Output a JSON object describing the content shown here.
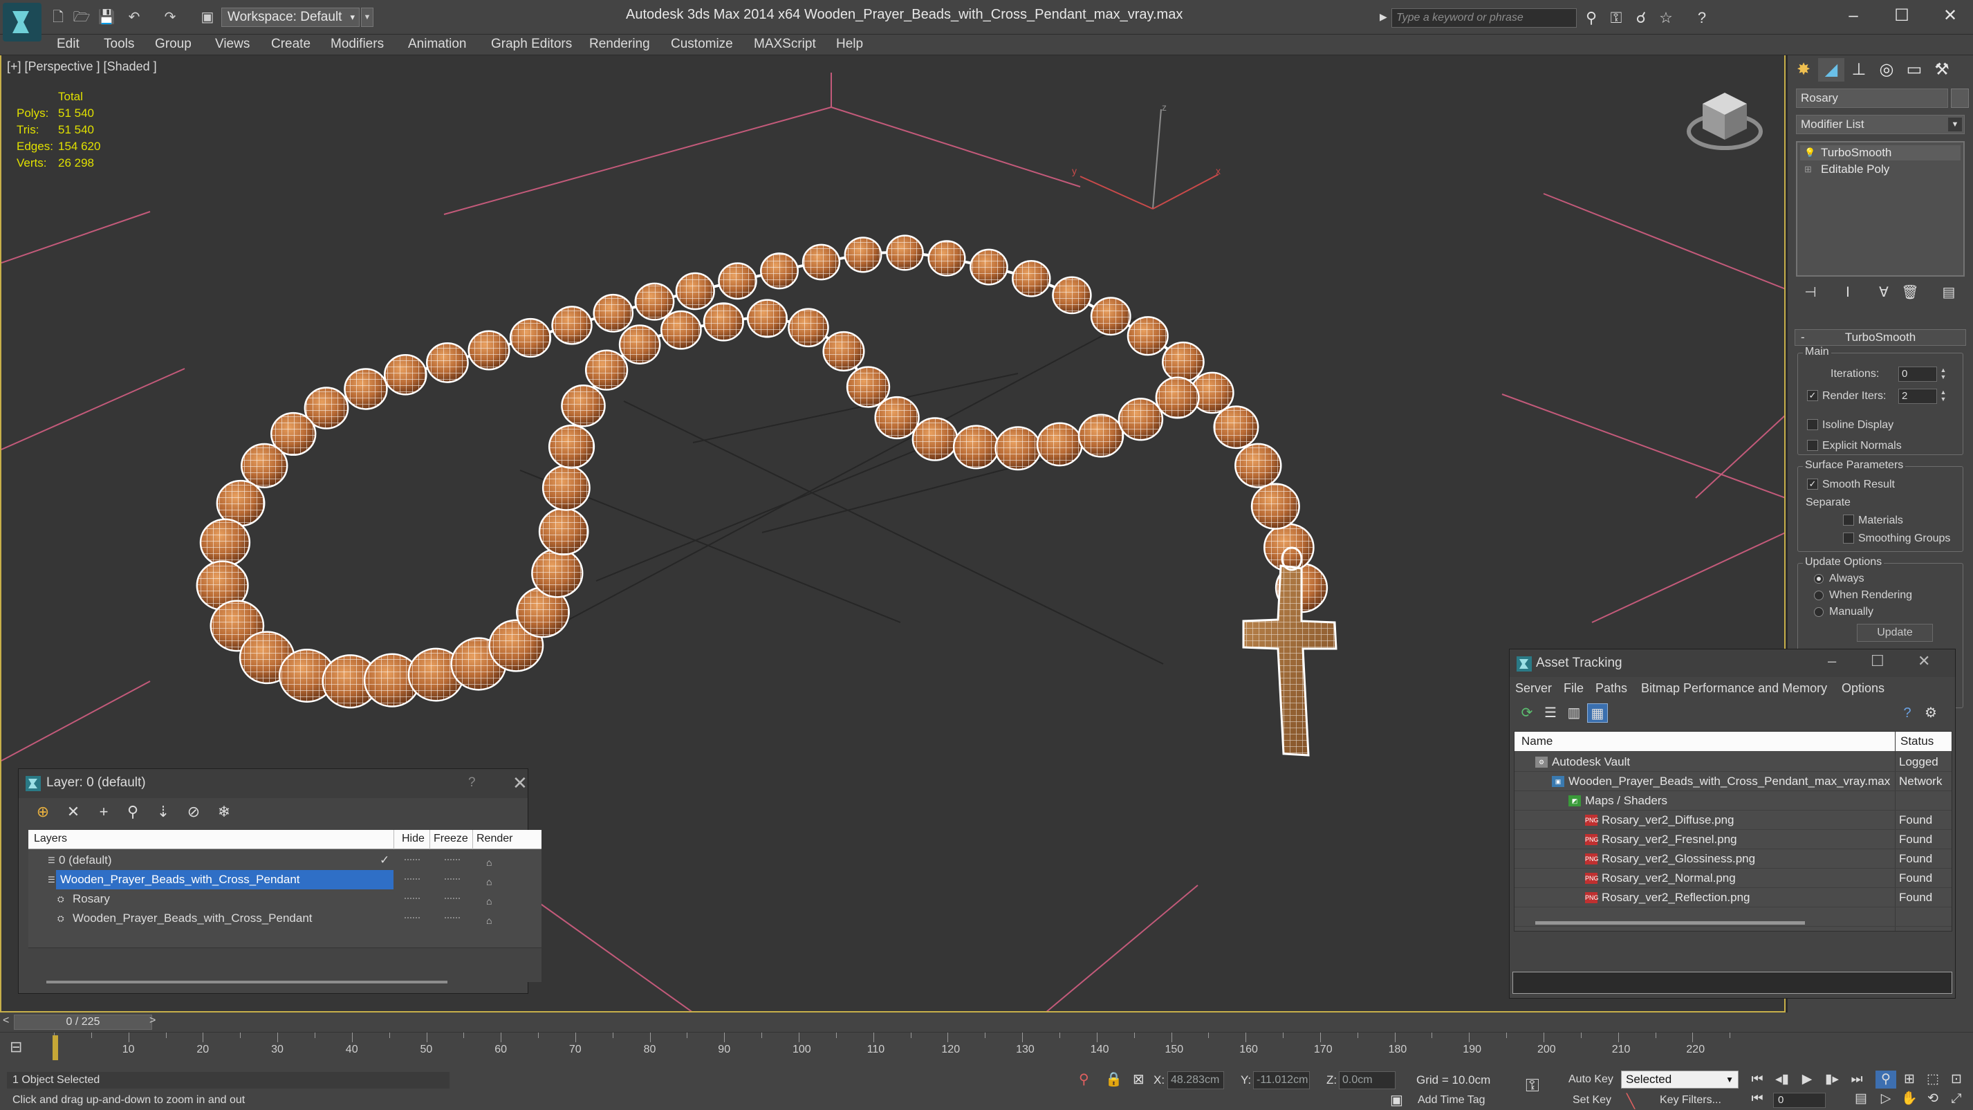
{
  "titlebar": {
    "workspace": "Workspace: Default",
    "app_title": "Autodesk 3ds Max  2014 x64",
    "file_title": "Wooden_Prayer_Beads_with_Cross_Pendant_max_vray.max",
    "search_placeholder": "Type a keyword or phrase",
    "minimize": "–",
    "maximize": "☐",
    "close": "✕"
  },
  "menubar": {
    "items": [
      "Edit",
      "Tools",
      "Group",
      "Views",
      "Create",
      "Modifiers",
      "Animation",
      "Graph Editors",
      "Rendering",
      "Customize",
      "MAXScript",
      "Help"
    ]
  },
  "viewport": {
    "label": "[+] [Perspective ] [Shaded ]",
    "stats": {
      "total_label": "Total",
      "rows": [
        {
          "k": "Polys:",
          "v": "51 540"
        },
        {
          "k": "Tris:",
          "v": "51 540"
        },
        {
          "k": "Edges:",
          "v": "154 620"
        },
        {
          "k": "Verts:",
          "v": "26 298"
        }
      ]
    },
    "axis_labels": {
      "y": "y",
      "x": "x",
      "z": "z"
    }
  },
  "command_panel": {
    "object_name": "Rosary",
    "modifier_list": "Modifier List",
    "stack": [
      "TurboSmooth",
      "Editable Poly"
    ],
    "rollout_title": "TurboSmooth",
    "main_group": "Main",
    "iterations_label": "Iterations:",
    "iterations_value": "0",
    "render_iters_label": "Render Iters:",
    "render_iters_value": "2",
    "isoline": "Isoline Display",
    "explicit_normals": "Explicit Normals",
    "surface_group": "Surface Parameters",
    "smooth_result": "Smooth Result",
    "separate": "Separate",
    "materials": "Materials",
    "smoothing_groups": "Smoothing Groups",
    "update_group": "Update Options",
    "always": "Always",
    "when_rendering": "When Rendering",
    "manually": "Manually",
    "update_btn": "Update"
  },
  "layer_window": {
    "title": "Layer: 0 (default)",
    "help": "?",
    "close": "✕",
    "headers": {
      "layers": "Layers",
      "hide": "Hide",
      "freeze": "Freeze",
      "render": "Render"
    },
    "rows": [
      {
        "name": "0 (default)",
        "indent": 0,
        "selected": false,
        "check": "✓"
      },
      {
        "name": "Wooden_Prayer_Beads_with_Cross_Pendant",
        "indent": 0,
        "selected": true,
        "check": ""
      },
      {
        "name": "Rosary",
        "indent": 1,
        "selected": false,
        "check": ""
      },
      {
        "name": "Wooden_Prayer_Beads_with_Cross_Pendant",
        "indent": 1,
        "selected": false,
        "check": ""
      }
    ]
  },
  "asset_window": {
    "title": "Asset Tracking",
    "menu": [
      "Server",
      "File",
      "Paths",
      "Bitmap Performance and Memory",
      "Options"
    ],
    "headers": {
      "name": "Name",
      "status": "Status"
    },
    "rows": [
      {
        "name": "Autodesk Vault",
        "status": "Logged",
        "indent": 0,
        "icon": "vault"
      },
      {
        "name": "Wooden_Prayer_Beads_with_Cross_Pendant_max_vray.max",
        "status": "Network",
        "indent": 1,
        "icon": "max"
      },
      {
        "name": "Maps / Shaders",
        "status": "",
        "indent": 2,
        "icon": "maps"
      },
      {
        "name": "Rosary_ver2_Diffuse.png",
        "status": "Found",
        "indent": 3,
        "icon": "png"
      },
      {
        "name": "Rosary_ver2_Fresnel.png",
        "status": "Found",
        "indent": 3,
        "icon": "png"
      },
      {
        "name": "Rosary_ver2_Glossiness.png",
        "status": "Found",
        "indent": 3,
        "icon": "png"
      },
      {
        "name": "Rosary_ver2_Normal.png",
        "status": "Found",
        "indent": 3,
        "icon": "png"
      },
      {
        "name": "Rosary_ver2_Reflection.png",
        "status": "Found",
        "indent": 3,
        "icon": "png"
      }
    ]
  },
  "timeline": {
    "slider": "0 / 225",
    "ticks": [
      0,
      10,
      20,
      30,
      40,
      50,
      60,
      70,
      80,
      90,
      100,
      110,
      120,
      130,
      140,
      150,
      160,
      170,
      180,
      190,
      200,
      210,
      220
    ]
  },
  "statusbar": {
    "selection": "1 Object Selected",
    "prompt": "Click and drag up-and-down to zoom in and out",
    "x_label": "X:",
    "x_value": "48.283cm",
    "y_label": "Y:",
    "y_value": "-11.012cm",
    "z_label": "Z:",
    "z_value": "0.0cm",
    "grid": "Grid = 10.0cm",
    "add_time_tag": "Add Time Tag",
    "auto_key": "Auto Key",
    "set_key": "Set Key",
    "selected": "Selected",
    "key_filters": "Key Filters...",
    "frame": "0"
  },
  "colors": {
    "viewport_bg": "#363636",
    "ui_bg": "#444444",
    "selection_blue": "#2f6fc6",
    "stats_yellow": "#e0e000",
    "viewport_border": "#c8b04a",
    "bead_wood": "#b86a34"
  }
}
